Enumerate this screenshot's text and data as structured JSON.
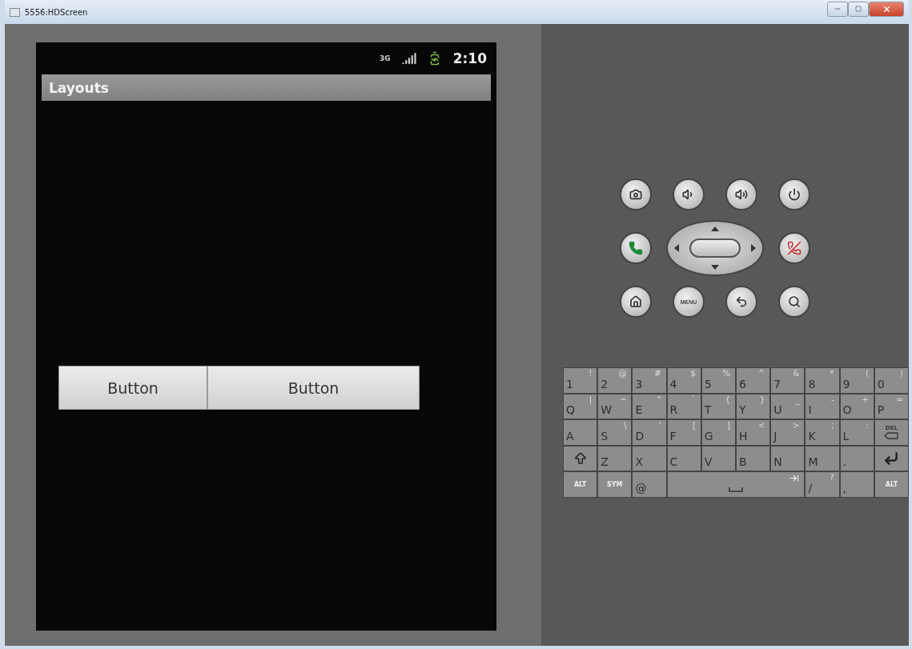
{
  "window": {
    "title": "5556:HDScreen"
  },
  "phone": {
    "status_bar": {
      "network": "3G",
      "time": "2:10"
    },
    "app_title": "Layouts",
    "buttons": [
      {
        "label": "Button"
      },
      {
        "label": "Button"
      }
    ]
  },
  "controls": [
    {
      "kind": "camera"
    },
    {
      "kind": "volume-down"
    },
    {
      "kind": "volume-up"
    },
    {
      "kind": "power"
    },
    {
      "kind": "call"
    },
    {
      "kind": "dpad"
    },
    {
      "kind": "end-call"
    },
    {
      "kind": "home"
    },
    {
      "kind": "menu",
      "label": "MENU"
    },
    {
      "kind": "back"
    },
    {
      "kind": "search"
    }
  ],
  "keyboard": [
    [
      {
        "kind": "char",
        "label": "1",
        "alt": "!"
      },
      {
        "kind": "char",
        "label": "2",
        "alt": "@"
      },
      {
        "kind": "char",
        "label": "3",
        "alt": "#"
      },
      {
        "kind": "char",
        "label": "4",
        "alt": "$"
      },
      {
        "kind": "char",
        "label": "5",
        "alt": "%"
      },
      {
        "kind": "char",
        "label": "6",
        "alt": "^"
      },
      {
        "kind": "char",
        "label": "7",
        "alt": "&"
      },
      {
        "kind": "char",
        "label": "8",
        "alt": "*"
      },
      {
        "kind": "char",
        "label": "9",
        "alt": "("
      },
      {
        "kind": "char",
        "label": "0",
        "alt": ")"
      }
    ],
    [
      {
        "kind": "char",
        "label": "Q",
        "alt": "|"
      },
      {
        "kind": "char",
        "label": "W",
        "alt": "~"
      },
      {
        "kind": "char",
        "label": "E",
        "alt": "\""
      },
      {
        "kind": "char",
        "label": "R",
        "alt": "`"
      },
      {
        "kind": "char",
        "label": "T",
        "alt": "{"
      },
      {
        "kind": "char",
        "label": "Y",
        "alt": "}"
      },
      {
        "kind": "char",
        "label": "U",
        "alt": "_"
      },
      {
        "kind": "char",
        "label": "I",
        "alt": "-"
      },
      {
        "kind": "char",
        "label": "O",
        "alt": "+"
      },
      {
        "kind": "char",
        "label": "P",
        "alt": "="
      }
    ],
    [
      {
        "kind": "char",
        "label": "A"
      },
      {
        "kind": "char",
        "label": "S",
        "alt": "\\"
      },
      {
        "kind": "char",
        "label": "D",
        "alt": "'"
      },
      {
        "kind": "char",
        "label": "F",
        "alt": "["
      },
      {
        "kind": "char",
        "label": "G",
        "alt": "]"
      },
      {
        "kind": "char",
        "label": "H",
        "alt": "<"
      },
      {
        "kind": "char",
        "label": "J",
        "alt": ">"
      },
      {
        "kind": "char",
        "label": "K",
        "alt": ";"
      },
      {
        "kind": "char",
        "label": "L",
        "alt": ":"
      },
      {
        "kind": "delete",
        "label": "DEL"
      }
    ],
    [
      {
        "kind": "shift"
      },
      {
        "kind": "char",
        "label": "Z"
      },
      {
        "kind": "char",
        "label": "X"
      },
      {
        "kind": "char",
        "label": "C"
      },
      {
        "kind": "char",
        "label": "V"
      },
      {
        "kind": "char",
        "label": "B"
      },
      {
        "kind": "char",
        "label": "N"
      },
      {
        "kind": "char",
        "label": "M"
      },
      {
        "kind": "char",
        "label": "."
      },
      {
        "kind": "enter"
      }
    ],
    [
      {
        "kind": "mod",
        "label": "ALT"
      },
      {
        "kind": "mod",
        "label": "SYM"
      },
      {
        "kind": "char",
        "label": "@"
      },
      {
        "kind": "space"
      },
      {
        "kind": "char",
        "label": "/",
        "alt": "?"
      },
      {
        "kind": "char",
        "label": ","
      },
      {
        "kind": "mod",
        "label": "ALT"
      }
    ]
  ]
}
